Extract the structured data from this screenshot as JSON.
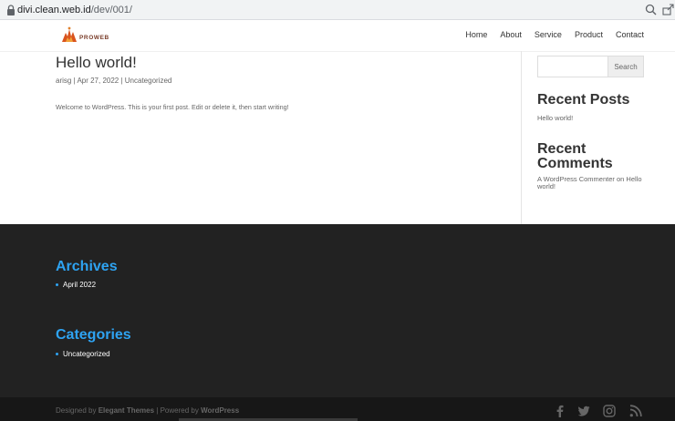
{
  "browser": {
    "url_host": "divi.clean.web.id",
    "url_path": "/dev/001/"
  },
  "header": {
    "logo_text": "PROWEB",
    "nav": [
      "Home",
      "About",
      "Service",
      "Product",
      "Contact"
    ]
  },
  "post": {
    "title": "Hello world!",
    "meta_author": "arisg",
    "meta_sep1": " | ",
    "meta_date": "Apr 27, 2022",
    "meta_sep2": " | ",
    "meta_category": "Uncategorized",
    "body": "Welcome to WordPress. This is your first post. Edit or delete it, then start writing!"
  },
  "sidebar": {
    "search_placeholder": "",
    "search_button": "Search",
    "recent_posts_title": "Recent Posts",
    "recent_posts": [
      "Hello world!"
    ],
    "recent_comments_title": "Recent Comments",
    "recent_comment_author": "A WordPress Commenter",
    "recent_comment_on": " on ",
    "recent_comment_post": "Hello world!"
  },
  "footer": {
    "archives_title": "Archives",
    "archives": [
      "April 2022"
    ],
    "categories_title": "Categories",
    "categories": [
      "Uncategorized"
    ],
    "credits_prefix": "Designed by ",
    "credits_theme": "Elegant Themes",
    "credits_mid": " | Powered by ",
    "credits_wp": "WordPress",
    "social_icons": [
      "facebook-icon",
      "twitter-icon",
      "instagram-icon",
      "rss-icon"
    ]
  },
  "colors": {
    "accent": "#2ea3f2",
    "footer_bg": "#222222",
    "bottom_bar_bg": "#171717"
  }
}
